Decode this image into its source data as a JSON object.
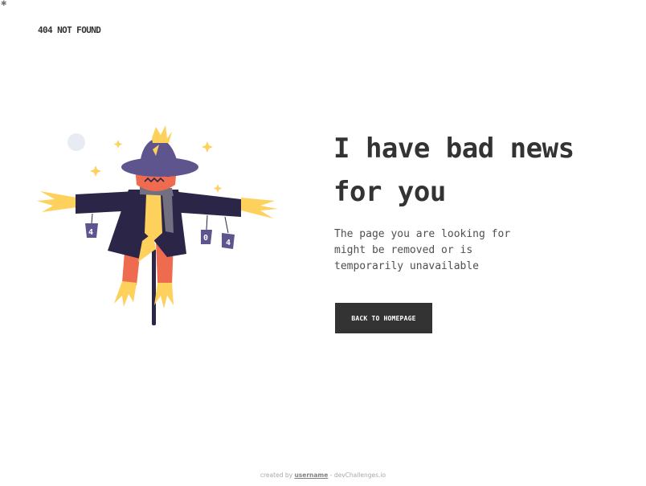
{
  "page": {
    "corner_glyph": "✱"
  },
  "header": {
    "brand": "404 NOT FOUND"
  },
  "illustration": {
    "name": "scarecrow",
    "can_labels": [
      "4",
      "0",
      "4"
    ]
  },
  "main": {
    "headline": "I have bad news for you",
    "message": "The page you are looking for might be removed or is temporarily unavailable",
    "button_label": "BACK TO HOMEPAGE"
  },
  "footer": {
    "prefix": "created by",
    "username": "username",
    "separator": " - ",
    "site": "devChallenges.io"
  },
  "colors": {
    "text": "#333333",
    "message": "#4f4f4f",
    "button_bg": "#333333",
    "button_text": "#ffffff",
    "coat": "#2b2547",
    "hat": "#5e558e",
    "face": "#ef6b50",
    "straw": "#fed15d",
    "scarf": "#716f80",
    "moon": "#e8ebf3"
  }
}
